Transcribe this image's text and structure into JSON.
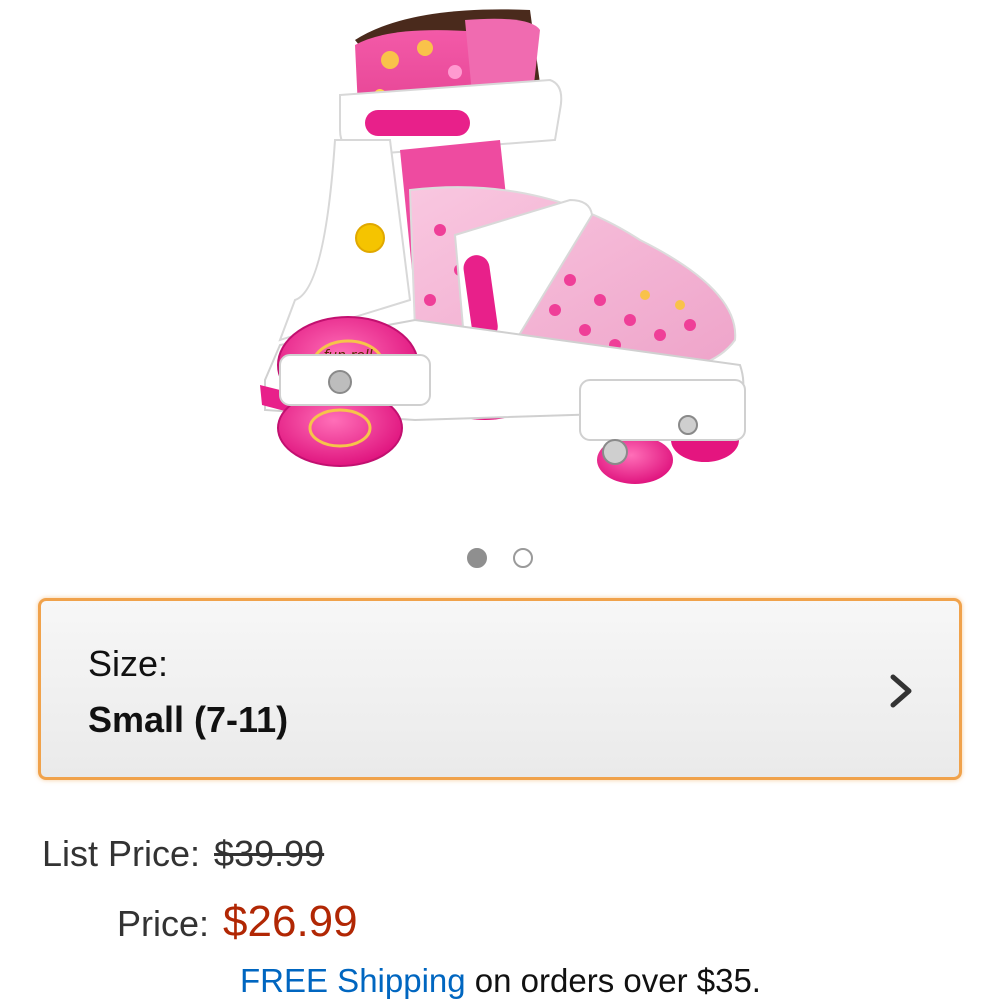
{
  "product": {
    "image_icon": "roller-skate-image",
    "image_text": "fun roll"
  },
  "carousel": {
    "dots": [
      {
        "state": "active"
      },
      {
        "state": "inactive"
      }
    ]
  },
  "size_selector": {
    "label": "Size:",
    "value": "Small (7-11)",
    "icon": "chevron-right-icon"
  },
  "pricing": {
    "list_price_label": "List Price:",
    "list_price": "$39.99",
    "price_label": "Price:",
    "price": "$26.99"
  },
  "shipping": {
    "link_text": "FREE Shipping",
    "rest_text": " on orders over $35."
  },
  "colors": {
    "accent_orange": "#f0a24b",
    "price_red": "#b12704",
    "link_blue": "#0066c0",
    "skate_pink": "#e8208a"
  }
}
